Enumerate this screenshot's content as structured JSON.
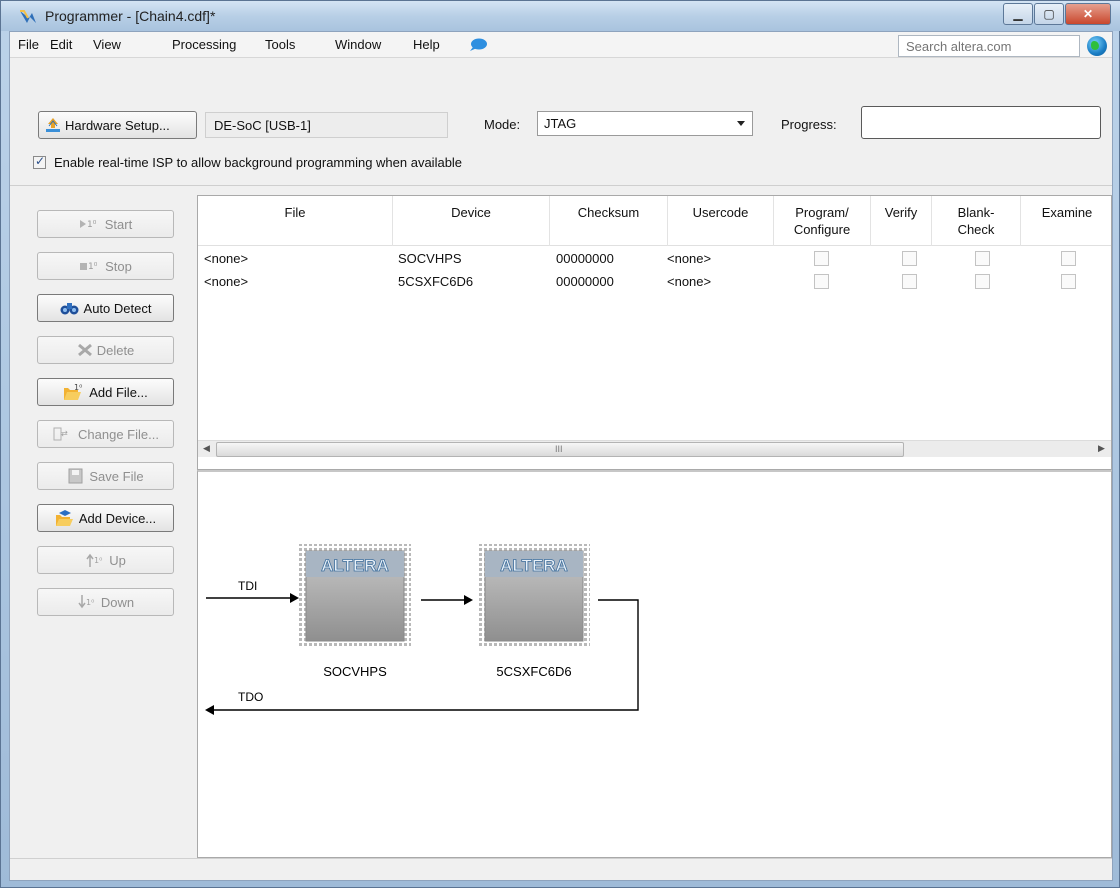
{
  "window": {
    "title": "Programmer - [Chain4.cdf]*"
  },
  "menu": {
    "items": [
      {
        "label": "File"
      },
      {
        "label": "Edit"
      },
      {
        "label": "View"
      },
      {
        "label": "Processing"
      },
      {
        "label": "Tools"
      },
      {
        "label": "Window"
      },
      {
        "label": "Help"
      }
    ],
    "search_placeholder": "Search altera.com"
  },
  "toolbar": {
    "hardware_setup_label": "Hardware Setup...",
    "hardware_value": "DE-SoC [USB-1]",
    "mode_label": "Mode:",
    "mode_value": "JTAG",
    "progress_label": "Progress:",
    "isp_label": "Enable real-time ISP to allow background programming when available",
    "isp_checked": true
  },
  "side_buttons": [
    {
      "label": "Start",
      "enabled": false
    },
    {
      "label": "Stop",
      "enabled": false
    },
    {
      "label": "Auto Detect",
      "enabled": true
    },
    {
      "label": "Delete",
      "enabled": false
    },
    {
      "label": "Add File...",
      "enabled": true
    },
    {
      "label": "Change File...",
      "enabled": false
    },
    {
      "label": "Save File",
      "enabled": false
    },
    {
      "label": "Add Device...",
      "enabled": true
    },
    {
      "label": "Up",
      "enabled": false
    },
    {
      "label": "Down",
      "enabled": false
    }
  ],
  "table": {
    "columns": [
      "File",
      "Device",
      "Checksum",
      "Usercode",
      "Program/\nConfigure",
      "Verify",
      "Blank-\nCheck",
      "Examine"
    ],
    "rows": [
      {
        "file": "<none>",
        "device": "SOCVHPS",
        "checksum": "00000000",
        "usercode": "<none>"
      },
      {
        "file": "<none>",
        "device": "5CSXFC6D6",
        "checksum": "00000000",
        "usercode": "<none>"
      }
    ]
  },
  "diagram": {
    "tdi_label": "TDI",
    "tdo_label": "TDO",
    "chip_brand": "ALTERA",
    "devices": [
      "SOCVHPS",
      "5CSXFC6D6"
    ]
  }
}
